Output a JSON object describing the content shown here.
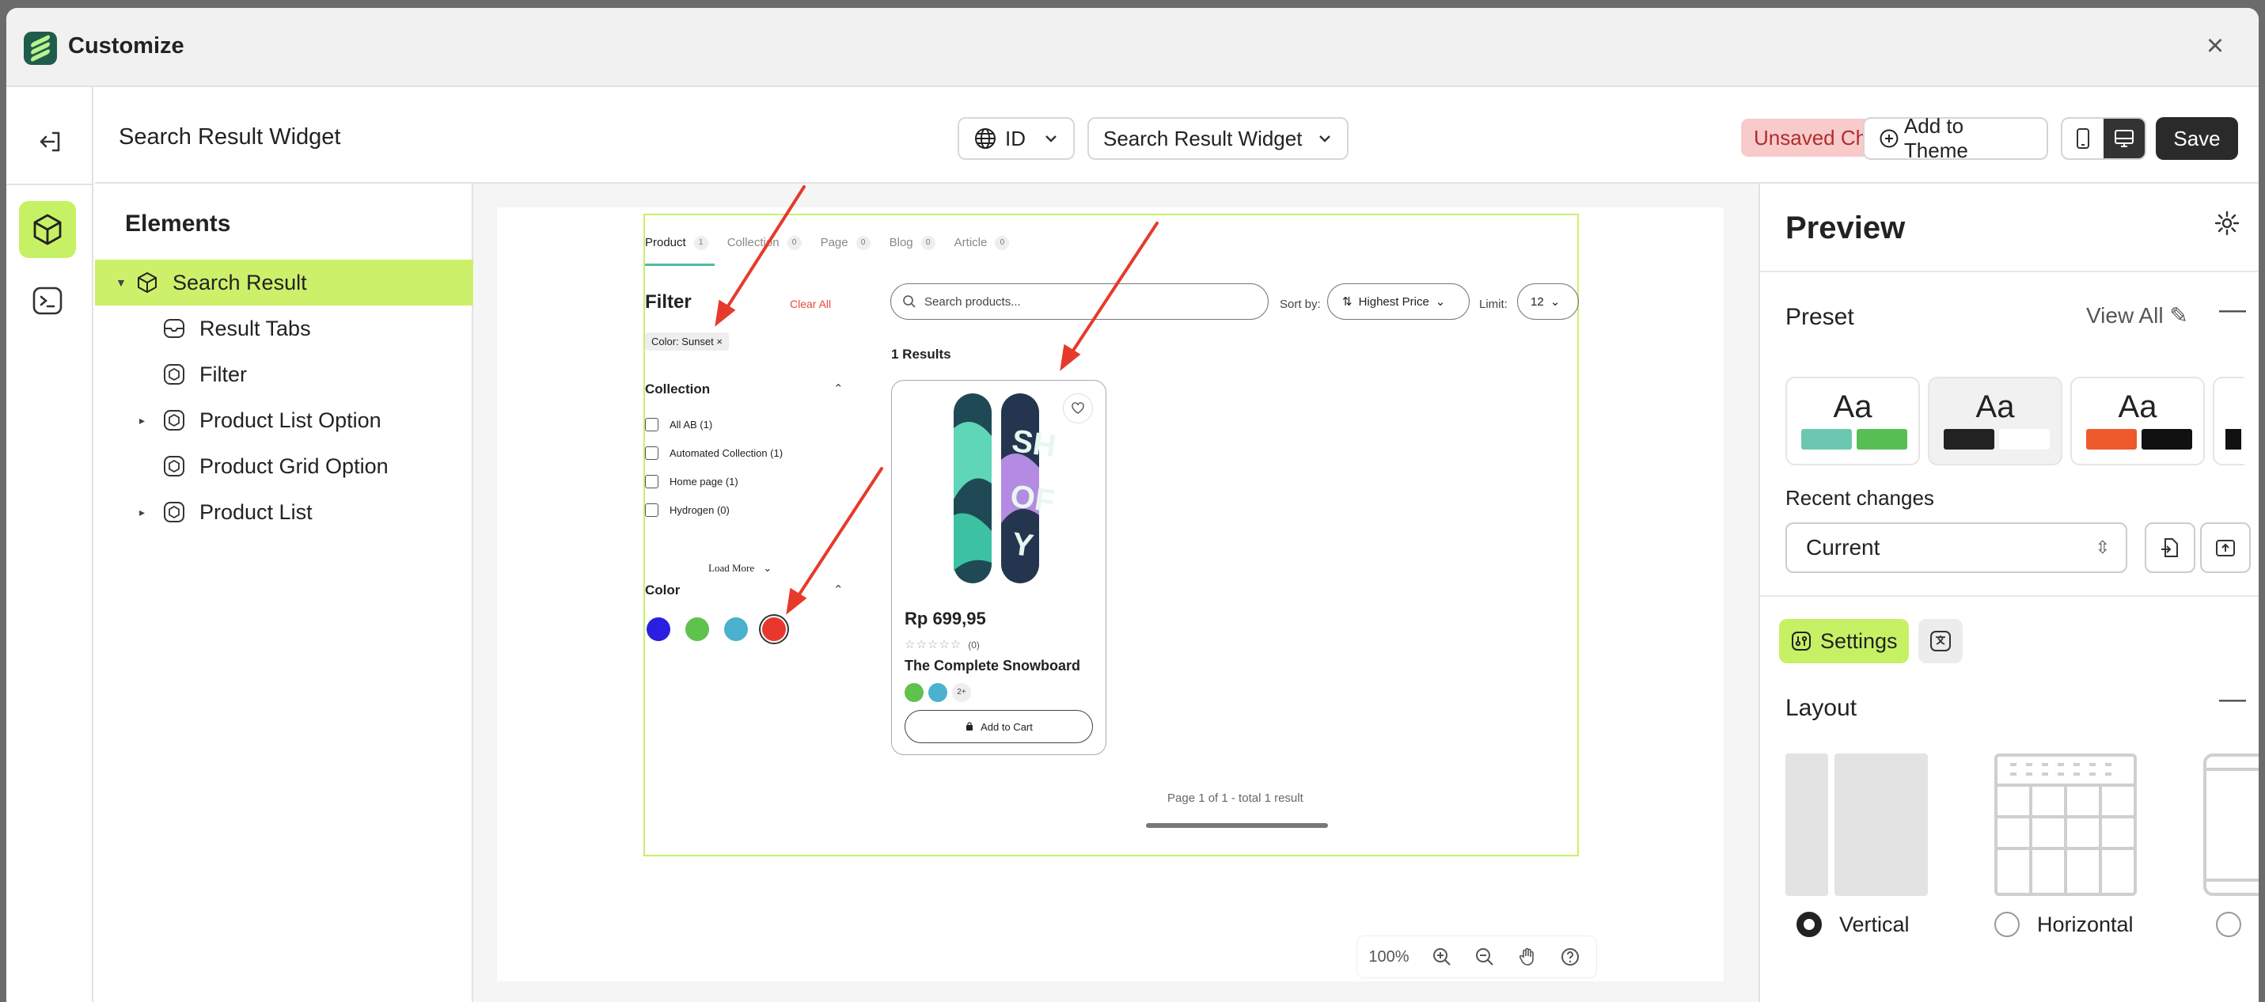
{
  "window": {
    "title": "Customize"
  },
  "topbar": {
    "page_title": "Search Result Widget",
    "language": "ID",
    "widget_select": "Search Result Widget",
    "unsaved": "Unsaved Changes",
    "add_to_theme": "Add to Theme",
    "save": "Save"
  },
  "elements": {
    "title": "Elements",
    "items": [
      {
        "label": "Search Result"
      },
      {
        "label": "Result Tabs"
      },
      {
        "label": "Filter"
      },
      {
        "label": "Product List Option"
      },
      {
        "label": "Product Grid Option"
      },
      {
        "label": "Product List"
      }
    ]
  },
  "canvas": {
    "tabs": [
      {
        "label": "Product",
        "count": "1"
      },
      {
        "label": "Collection",
        "count": "0"
      },
      {
        "label": "Page",
        "count": "0"
      },
      {
        "label": "Blog",
        "count": "0"
      },
      {
        "label": "Article",
        "count": "0"
      }
    ],
    "filter_title": "Filter",
    "clear_all": "Clear All",
    "active_chip": "Color: Sunset ×",
    "collection_title": "Collection",
    "collections": [
      {
        "label": "All AB (1)"
      },
      {
        "label": "Automated Collection (1)"
      },
      {
        "label": "Home page (1)"
      },
      {
        "label": "Hydrogen (0)"
      }
    ],
    "load_more": "Load More",
    "color_title": "Color",
    "swatches": [
      "#2a1fe0",
      "#5fc24c",
      "#4ab2cf",
      "#e8382e"
    ],
    "search_placeholder": "Search products...",
    "sort_label": "Sort by:",
    "sort_value": "Highest Price",
    "limit_label": "Limit:",
    "limit_value": "12",
    "results": "1 Results",
    "product": {
      "price": "Rp 699,95",
      "stars": "☆☆☆☆☆",
      "reviews": "(0)",
      "name": "The Complete Snowboard",
      "dot_colors": [
        "#5fc24c",
        "#4ab2cf"
      ],
      "more_colors": "2+",
      "add_to_cart": "Add to Cart"
    },
    "page_info": "Page 1 of 1 - total 1 result",
    "zoom": "100%"
  },
  "preview": {
    "title": "Preview",
    "preset_label": "Preset",
    "view_all": "View All",
    "presets": [
      {
        "label": "Aa",
        "c1": "#6cc7b0",
        "c2": "#56bf54"
      },
      {
        "label": "Aa",
        "c1": "#222222",
        "c2": "#ffffff"
      },
      {
        "label": "Aa",
        "c1": "#ef5a2c",
        "c2": "#111111"
      }
    ],
    "recent_label": "Recent changes",
    "recent_value": "Current",
    "settings_tab": "Settings",
    "layout_label": "Layout",
    "layout_options": [
      {
        "label": "Vertical"
      },
      {
        "label": "Horizontal"
      }
    ]
  },
  "colors": {
    "accent": "#c7f165",
    "annotation_arrow": "#e63a2a"
  }
}
